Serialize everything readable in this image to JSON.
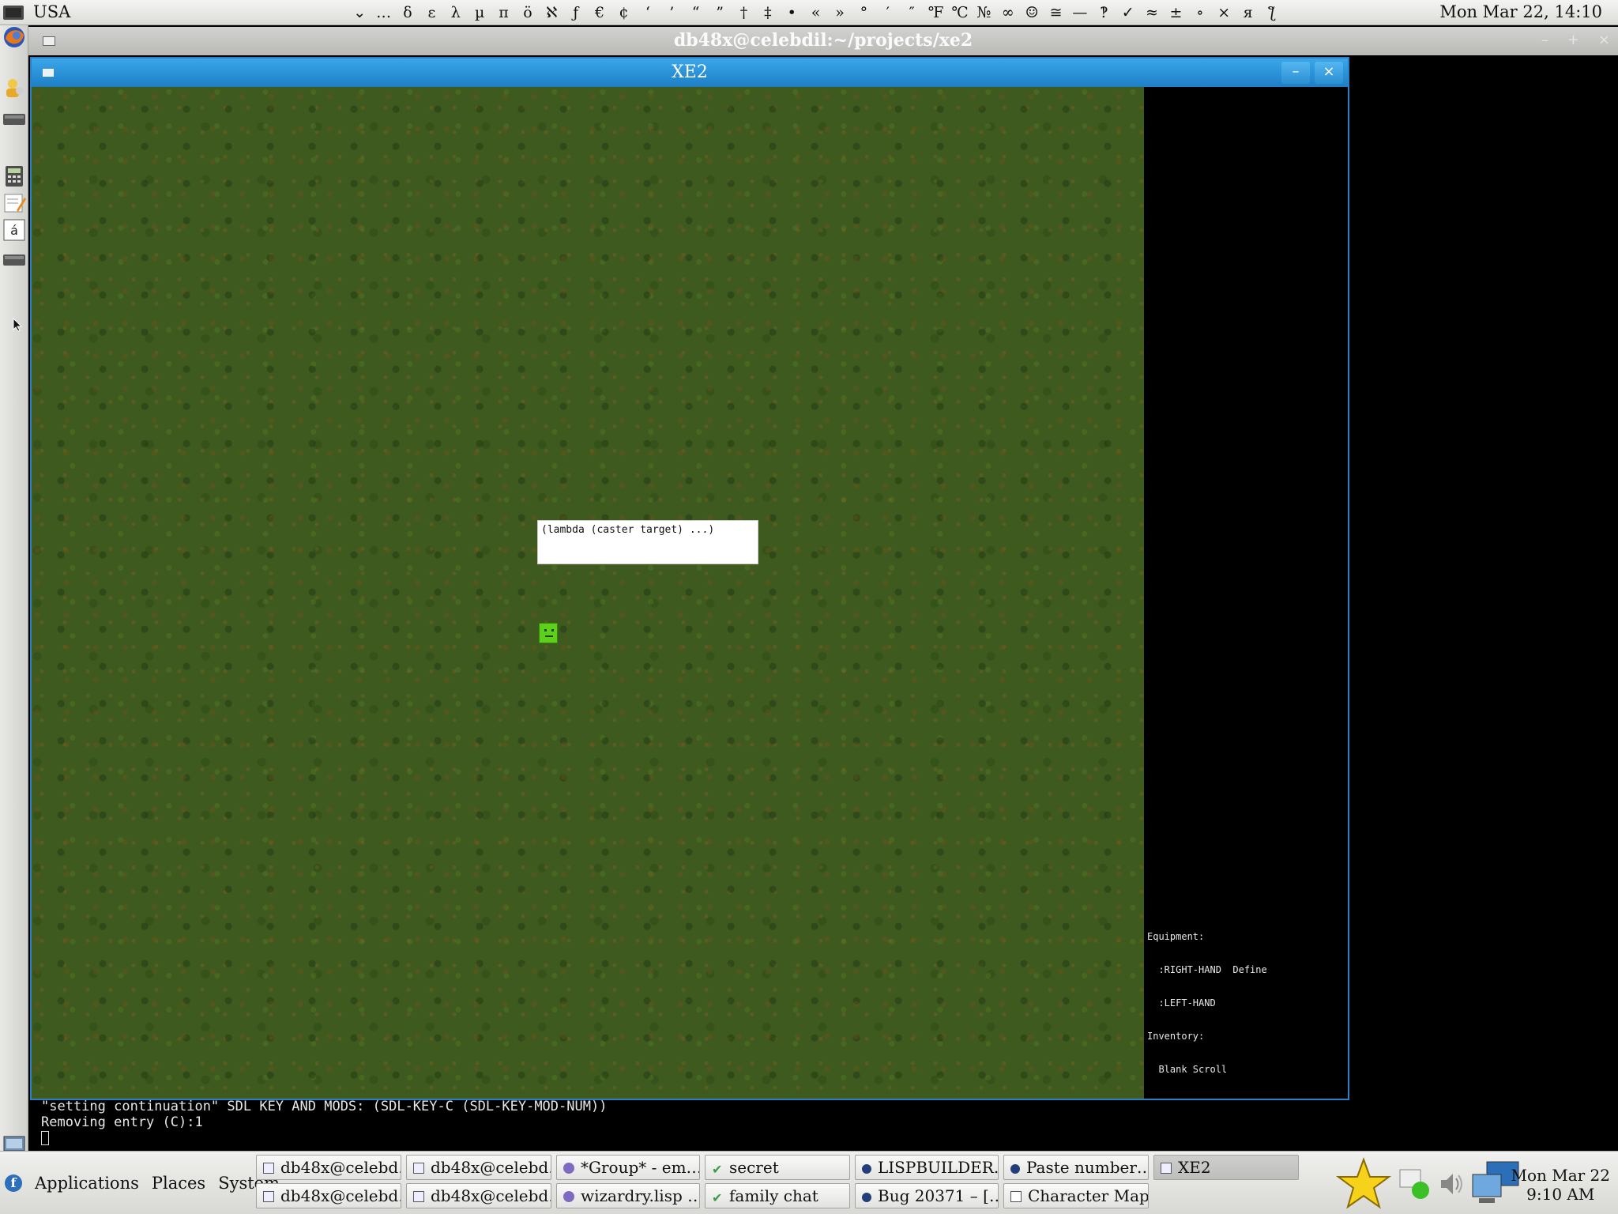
{
  "top_panel": {
    "layout_label": "USA",
    "char_palette": [
      "⌄",
      "…",
      "δ",
      "ε",
      "λ",
      "µ",
      "π",
      "ö",
      "ℵ",
      "ƒ",
      "€",
      "¢",
      "‘",
      "’",
      "“",
      "”",
      "†",
      "‡",
      "•",
      "«",
      "»",
      "°",
      "′",
      "″",
      "℉",
      "℃",
      "№",
      "∞",
      "☺",
      "≅",
      "—",
      "‽",
      "✓",
      "≈",
      "±",
      "∘",
      "×",
      "я",
      "ƪ"
    ],
    "clock": "Mon Mar 22, 14:10"
  },
  "terminal_window": {
    "title": "db48x@celebdil:~/projects/xe2",
    "controls": [
      "–",
      "+",
      "×"
    ],
    "output": [
      "\"setting continuation\" SDL KEY AND MODS: (SDL-KEY-C (SDL-KEY-MOD-NUM))",
      "Removing entry (C):1"
    ]
  },
  "xe2_window": {
    "title": "XE2",
    "minimize_label": "–",
    "close_label": "×",
    "prompt_text": "(lambda (caster target) ...)",
    "status_lines": [
      "Equipment:",
      "  :RIGHT-HAND  Define",
      "  :LEFT-HAND",
      "Inventory:",
      "  Blank Scroll"
    ]
  },
  "bottom_panel": {
    "menu": [
      "Applications",
      "Places",
      "System"
    ],
    "tasks": [
      {
        "label": "db48x@celebd…",
        "icon": "terminal-icon"
      },
      {
        "label": "db48x@celebd…",
        "icon": "terminal-icon"
      },
      {
        "label": "*Group* - em…",
        "icon": "emacs-icon"
      },
      {
        "label": "secret",
        "icon": "chat-icon"
      },
      {
        "label": "LISPBUILDER…",
        "icon": "browser-icon"
      },
      {
        "label": "Paste number…",
        "icon": "browser-icon"
      },
      {
        "label": "XE2",
        "icon": "terminal-icon"
      },
      {
        "label": "db48x@celebd…",
        "icon": "terminal-icon"
      },
      {
        "label": "db48x@celebd…",
        "icon": "terminal-icon"
      },
      {
        "label": "wizardry.lisp …",
        "icon": "emacs-icon"
      },
      {
        "label": "family chat",
        "icon": "chat-icon"
      },
      {
        "label": "Bug 20371 – […",
        "icon": "browser-icon"
      },
      {
        "label": "Character Map",
        "icon": "charmap-icon"
      }
    ],
    "clock_line1": "Mon Mar 22",
    "clock_line2": "9:10 AM"
  },
  "colors": {
    "xe2_title_blue": "#2e8fd6",
    "grass": "#3e5a1e",
    "player": "#5ecf1c"
  }
}
